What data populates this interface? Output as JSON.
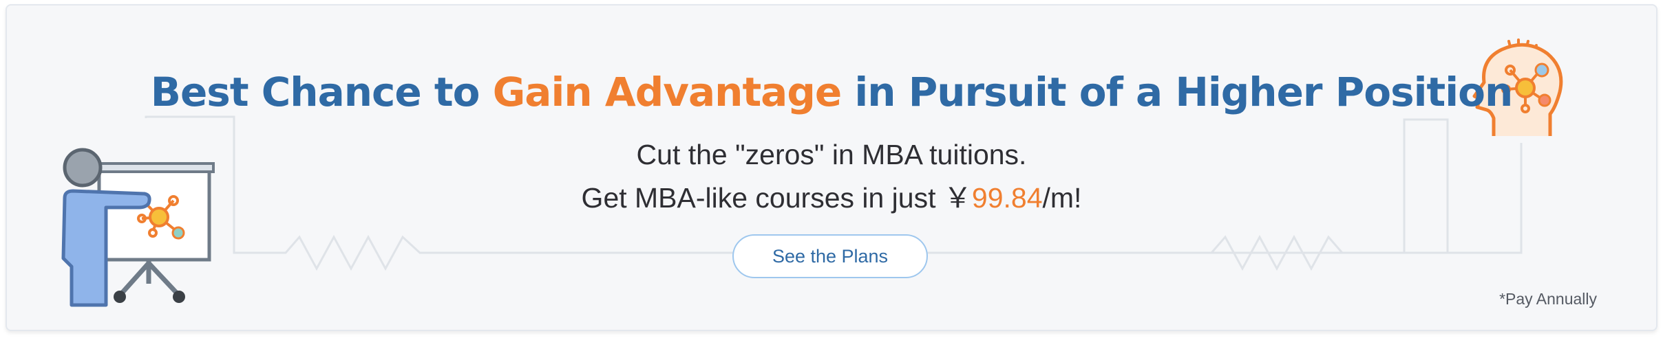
{
  "banner": {
    "title_part1": "Best Chance to ",
    "title_highlight": "Gain Advantage",
    "title_part2": " in Pursuit of a Higher Position",
    "subtitle_line1": "Cut the \"zeros\" in MBA tuitions.",
    "subtitle_line2_prefix": "Get MBA-like courses in just ￥",
    "price": "99.84",
    "subtitle_line2_suffix": "/m!",
    "cta_label": "See the Plans",
    "note": "*Pay Annually"
  },
  "icons": {
    "left": "presenter-whiteboard-icon",
    "right": "head-network-icon"
  },
  "colors": {
    "title_blue": "#2f6aa5",
    "accent_orange": "#f07f30",
    "background": "#f6f7f9",
    "button_border": "#9ec7ee"
  }
}
